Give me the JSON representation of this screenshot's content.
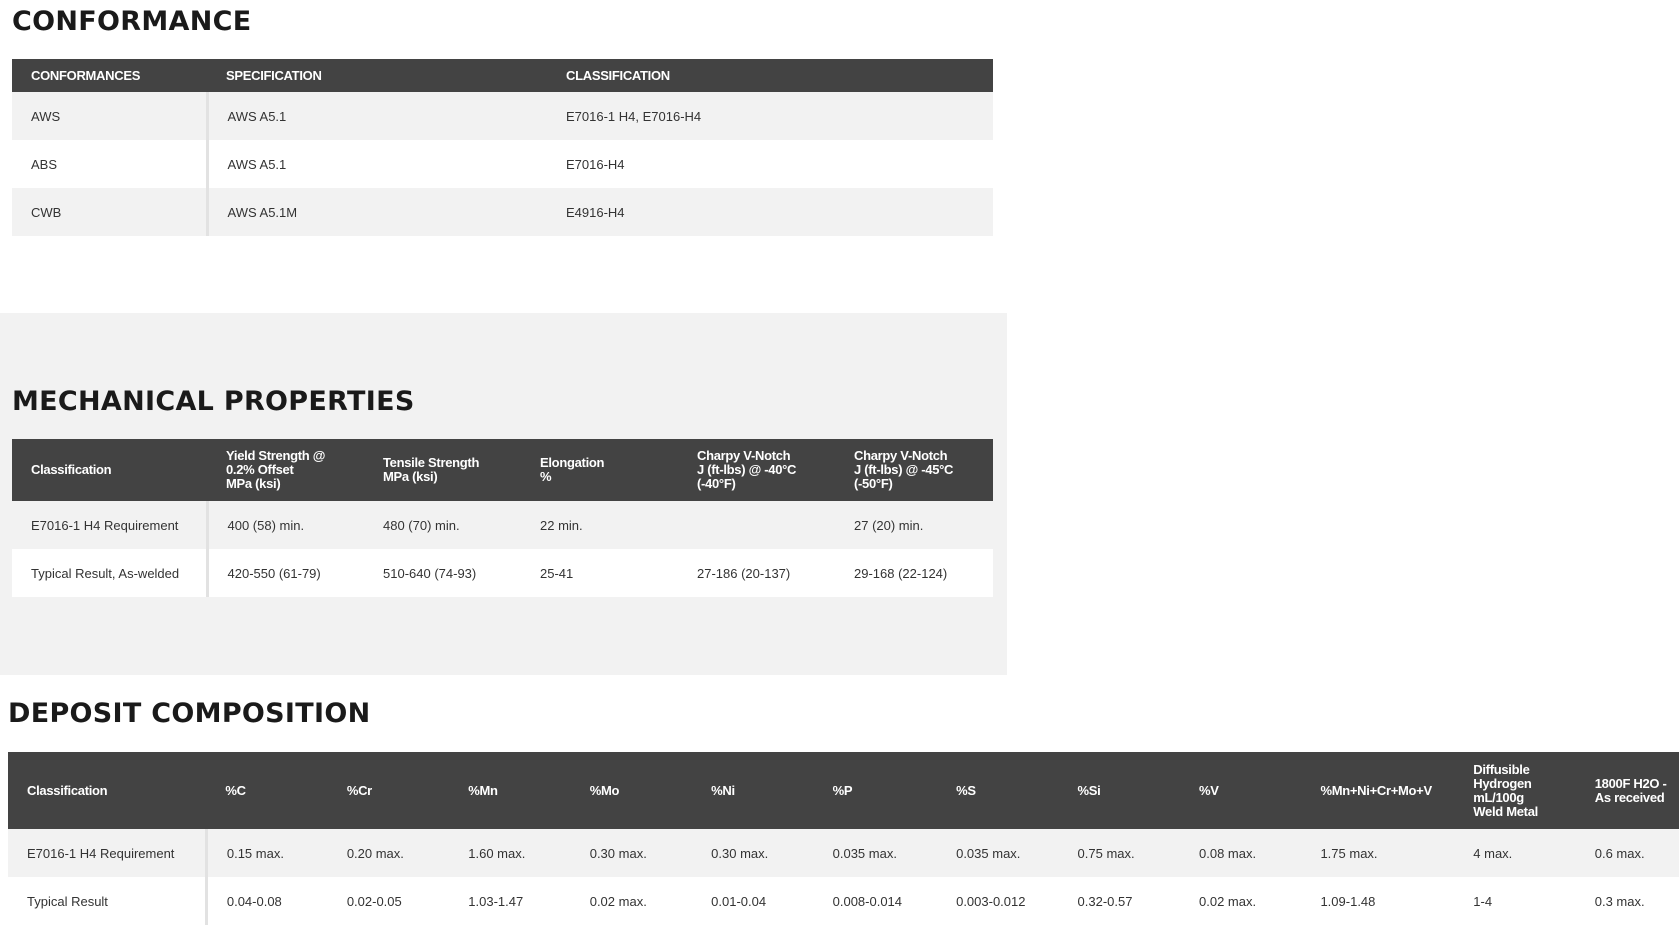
{
  "conformance": {
    "title": "CONFORMANCE",
    "headers": [
      "CONFORMANCES",
      "SPECIFICATION",
      "CLASSIFICATION"
    ],
    "rows": [
      [
        "AWS",
        "AWS A5.1",
        "E7016-1 H4, E7016-H4"
      ],
      [
        "ABS",
        "AWS A5.1",
        "E7016-H4"
      ],
      [
        "CWB",
        "AWS A5.1M",
        "E4916-H4"
      ]
    ]
  },
  "mechanical": {
    "title": "MECHANICAL PROPERTIES",
    "headers": [
      "Classification",
      "Yield Strength @\n0.2% Offset\nMPa (ksi)",
      "Tensile Strength\nMPa (ksi)",
      "Elongation\n%",
      "Charpy V-Notch\nJ (ft-lbs) @ -40°C\n(-40°F)",
      "Charpy V-Notch\nJ (ft-lbs) @ -45°C\n(-50°F)"
    ],
    "rows": [
      [
        "E7016-1 H4 Requirement",
        "400 (58) min.",
        "480 (70) min.",
        "22 min.",
        "",
        "27 (20) min."
      ],
      [
        "Typical Result, As-welded",
        "420-550 (61-79)",
        "510-640 (74-93)",
        "25-41",
        "27-186 (20-137)",
        "29-168 (22-124)"
      ]
    ]
  },
  "deposit": {
    "title": "DEPOSIT COMPOSITION",
    "headers": [
      "Classification",
      "%C",
      "%Cr",
      "%Mn",
      "%Mo",
      "%Ni",
      "%P",
      "%S",
      "%Si",
      "%V",
      "%Mn+Ni+Cr+Mo+V",
      "Diffusible\nHydrogen\nmL/100g\nWeld Metal",
      "1800F H2O -\nAs received"
    ],
    "rows": [
      [
        "E7016-1 H4 Requirement",
        "0.15 max.",
        "0.20 max.",
        "1.60 max.",
        "0.30 max.",
        "0.30 max.",
        "0.035 max.",
        "0.035 max.",
        "0.75 max.",
        "0.08 max.",
        "1.75 max.",
        "4 max.",
        "0.6 max."
      ],
      [
        "Typical Result",
        "0.04-0.08",
        "0.02-0.05",
        "1.03-1.47",
        "0.02 max.",
        "0.01-0.04",
        "0.008-0.014",
        "0.003-0.012",
        "0.32-0.57",
        "0.02 max.",
        "1.09-1.48",
        "1-4",
        "0.3 max."
      ]
    ]
  }
}
